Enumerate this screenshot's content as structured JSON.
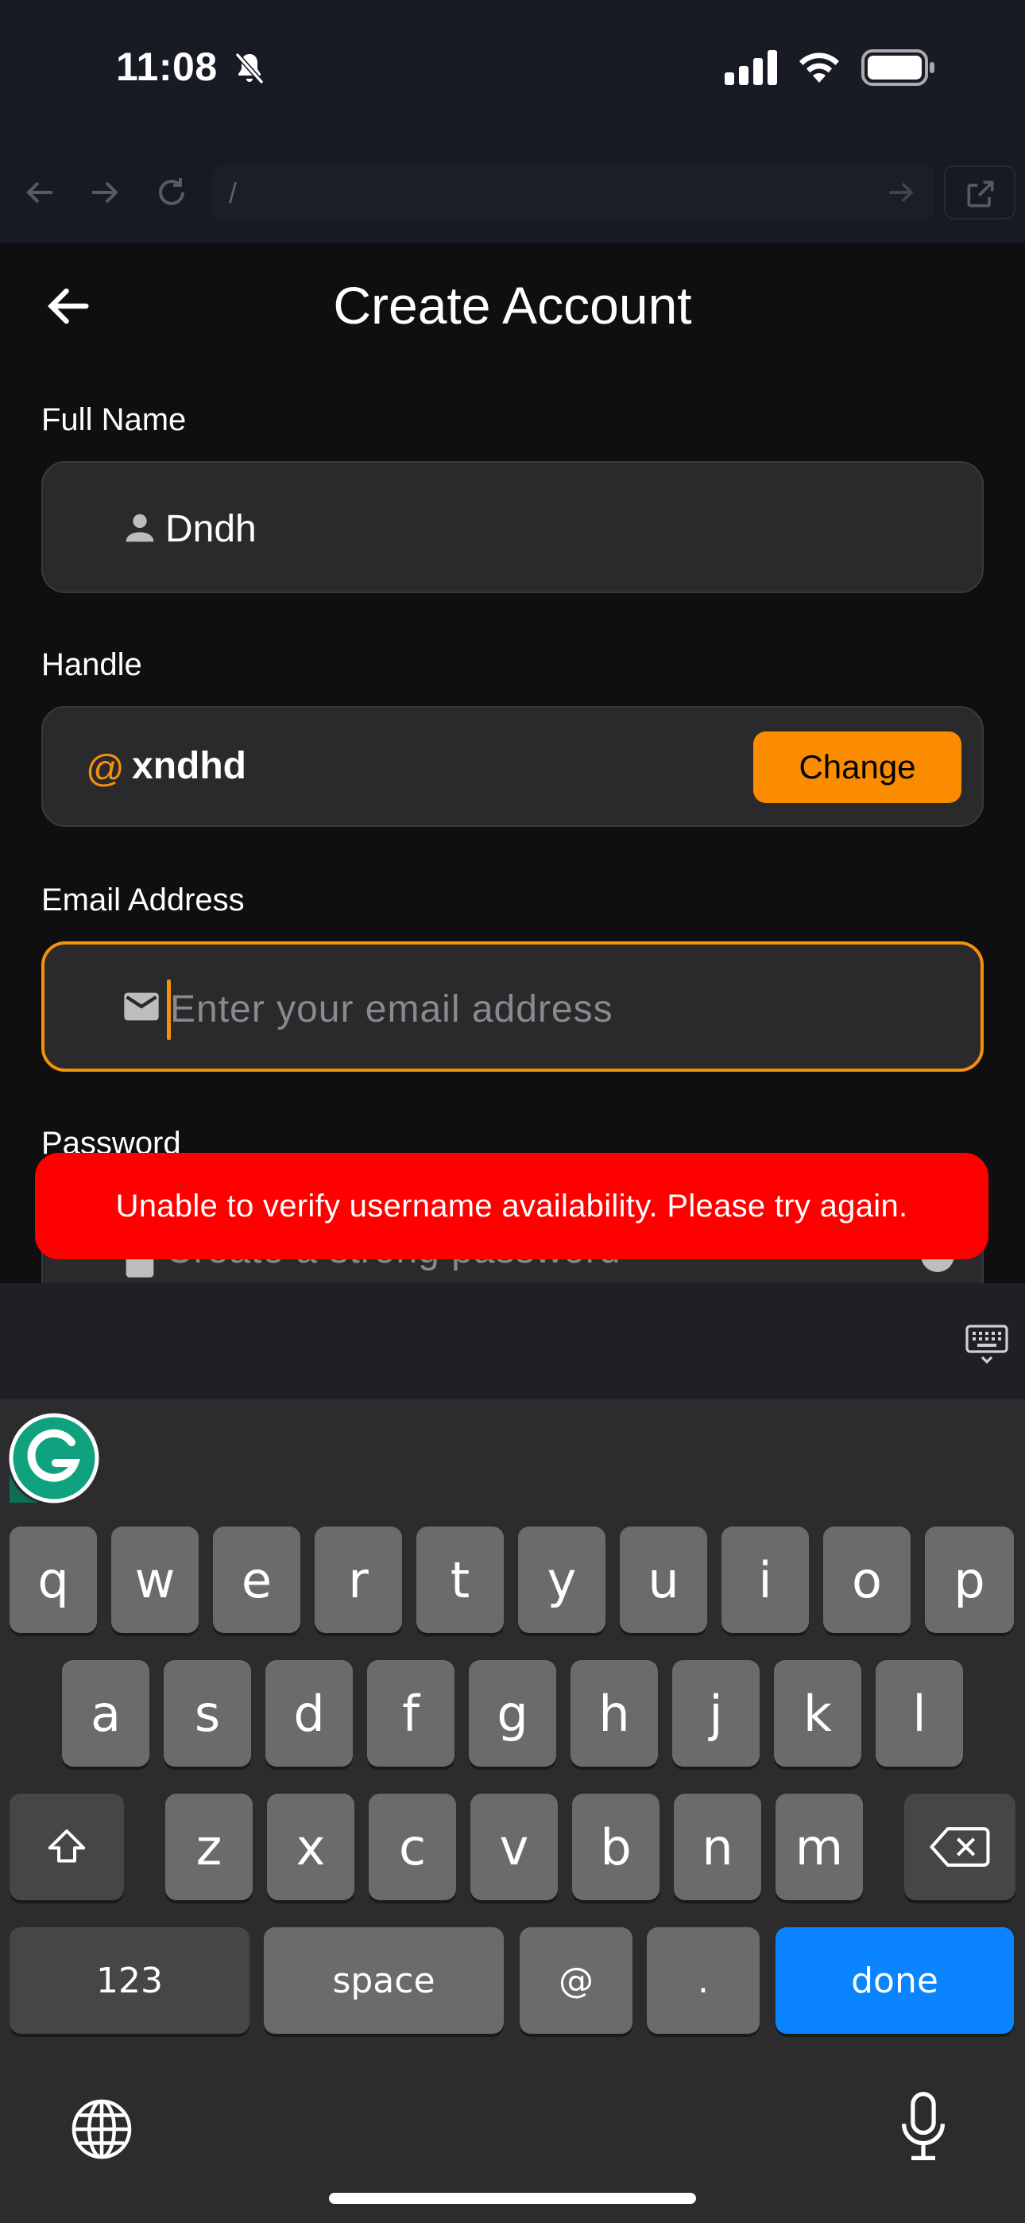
{
  "status_bar": {
    "time": "11:08"
  },
  "browser": {
    "url": "/"
  },
  "header": {
    "title": "Create Account"
  },
  "form": {
    "full_name": {
      "label": "Full Name",
      "value": "Dndh"
    },
    "handle": {
      "label": "Handle",
      "prefix": "@",
      "value": "xndhd",
      "change_label": "Change"
    },
    "email": {
      "label": "Email Address",
      "placeholder": "Enter your email address",
      "value": ""
    },
    "password": {
      "label": "Password",
      "placeholder": "Create a strong password"
    }
  },
  "toast": {
    "message": "Unable to verify username availability. Please try again."
  },
  "colors": {
    "accent": "#fb8c00",
    "error": "#ff0000",
    "done_key": "#0a84ff"
  },
  "keyboard": {
    "row1": [
      "q",
      "w",
      "e",
      "r",
      "t",
      "y",
      "u",
      "i",
      "o",
      "p"
    ],
    "row2": [
      "a",
      "s",
      "d",
      "f",
      "g",
      "h",
      "j",
      "k",
      "l"
    ],
    "row3": [
      "z",
      "x",
      "c",
      "v",
      "b",
      "n",
      "m"
    ],
    "numbers": "123",
    "space": "space",
    "at": "@",
    "period": ".",
    "done": "done"
  }
}
